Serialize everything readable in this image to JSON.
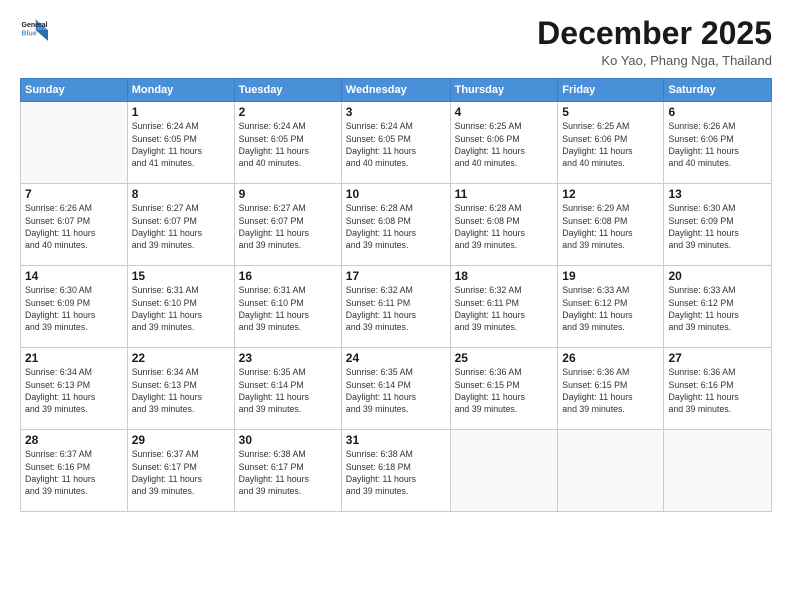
{
  "logo": {
    "line1": "General",
    "line2": "Blue"
  },
  "title": "December 2025",
  "location": "Ko Yao, Phang Nga, Thailand",
  "weekdays": [
    "Sunday",
    "Monday",
    "Tuesday",
    "Wednesday",
    "Thursday",
    "Friday",
    "Saturday"
  ],
  "weeks": [
    [
      {
        "day": "",
        "info": ""
      },
      {
        "day": "1",
        "info": "Sunrise: 6:24 AM\nSunset: 6:05 PM\nDaylight: 11 hours\nand 41 minutes."
      },
      {
        "day": "2",
        "info": "Sunrise: 6:24 AM\nSunset: 6:05 PM\nDaylight: 11 hours\nand 40 minutes."
      },
      {
        "day": "3",
        "info": "Sunrise: 6:24 AM\nSunset: 6:05 PM\nDaylight: 11 hours\nand 40 minutes."
      },
      {
        "day": "4",
        "info": "Sunrise: 6:25 AM\nSunset: 6:06 PM\nDaylight: 11 hours\nand 40 minutes."
      },
      {
        "day": "5",
        "info": "Sunrise: 6:25 AM\nSunset: 6:06 PM\nDaylight: 11 hours\nand 40 minutes."
      },
      {
        "day": "6",
        "info": "Sunrise: 6:26 AM\nSunset: 6:06 PM\nDaylight: 11 hours\nand 40 minutes."
      }
    ],
    [
      {
        "day": "7",
        "info": "Sunrise: 6:26 AM\nSunset: 6:07 PM\nDaylight: 11 hours\nand 40 minutes."
      },
      {
        "day": "8",
        "info": "Sunrise: 6:27 AM\nSunset: 6:07 PM\nDaylight: 11 hours\nand 39 minutes."
      },
      {
        "day": "9",
        "info": "Sunrise: 6:27 AM\nSunset: 6:07 PM\nDaylight: 11 hours\nand 39 minutes."
      },
      {
        "day": "10",
        "info": "Sunrise: 6:28 AM\nSunset: 6:08 PM\nDaylight: 11 hours\nand 39 minutes."
      },
      {
        "day": "11",
        "info": "Sunrise: 6:28 AM\nSunset: 6:08 PM\nDaylight: 11 hours\nand 39 minutes."
      },
      {
        "day": "12",
        "info": "Sunrise: 6:29 AM\nSunset: 6:08 PM\nDaylight: 11 hours\nand 39 minutes."
      },
      {
        "day": "13",
        "info": "Sunrise: 6:30 AM\nSunset: 6:09 PM\nDaylight: 11 hours\nand 39 minutes."
      }
    ],
    [
      {
        "day": "14",
        "info": "Sunrise: 6:30 AM\nSunset: 6:09 PM\nDaylight: 11 hours\nand 39 minutes."
      },
      {
        "day": "15",
        "info": "Sunrise: 6:31 AM\nSunset: 6:10 PM\nDaylight: 11 hours\nand 39 minutes."
      },
      {
        "day": "16",
        "info": "Sunrise: 6:31 AM\nSunset: 6:10 PM\nDaylight: 11 hours\nand 39 minutes."
      },
      {
        "day": "17",
        "info": "Sunrise: 6:32 AM\nSunset: 6:11 PM\nDaylight: 11 hours\nand 39 minutes."
      },
      {
        "day": "18",
        "info": "Sunrise: 6:32 AM\nSunset: 6:11 PM\nDaylight: 11 hours\nand 39 minutes."
      },
      {
        "day": "19",
        "info": "Sunrise: 6:33 AM\nSunset: 6:12 PM\nDaylight: 11 hours\nand 39 minutes."
      },
      {
        "day": "20",
        "info": "Sunrise: 6:33 AM\nSunset: 6:12 PM\nDaylight: 11 hours\nand 39 minutes."
      }
    ],
    [
      {
        "day": "21",
        "info": "Sunrise: 6:34 AM\nSunset: 6:13 PM\nDaylight: 11 hours\nand 39 minutes."
      },
      {
        "day": "22",
        "info": "Sunrise: 6:34 AM\nSunset: 6:13 PM\nDaylight: 11 hours\nand 39 minutes."
      },
      {
        "day": "23",
        "info": "Sunrise: 6:35 AM\nSunset: 6:14 PM\nDaylight: 11 hours\nand 39 minutes."
      },
      {
        "day": "24",
        "info": "Sunrise: 6:35 AM\nSunset: 6:14 PM\nDaylight: 11 hours\nand 39 minutes."
      },
      {
        "day": "25",
        "info": "Sunrise: 6:36 AM\nSunset: 6:15 PM\nDaylight: 11 hours\nand 39 minutes."
      },
      {
        "day": "26",
        "info": "Sunrise: 6:36 AM\nSunset: 6:15 PM\nDaylight: 11 hours\nand 39 minutes."
      },
      {
        "day": "27",
        "info": "Sunrise: 6:36 AM\nSunset: 6:16 PM\nDaylight: 11 hours\nand 39 minutes."
      }
    ],
    [
      {
        "day": "28",
        "info": "Sunrise: 6:37 AM\nSunset: 6:16 PM\nDaylight: 11 hours\nand 39 minutes."
      },
      {
        "day": "29",
        "info": "Sunrise: 6:37 AM\nSunset: 6:17 PM\nDaylight: 11 hours\nand 39 minutes."
      },
      {
        "day": "30",
        "info": "Sunrise: 6:38 AM\nSunset: 6:17 PM\nDaylight: 11 hours\nand 39 minutes."
      },
      {
        "day": "31",
        "info": "Sunrise: 6:38 AM\nSunset: 6:18 PM\nDaylight: 11 hours\nand 39 minutes."
      },
      {
        "day": "",
        "info": ""
      },
      {
        "day": "",
        "info": ""
      },
      {
        "day": "",
        "info": ""
      }
    ]
  ]
}
